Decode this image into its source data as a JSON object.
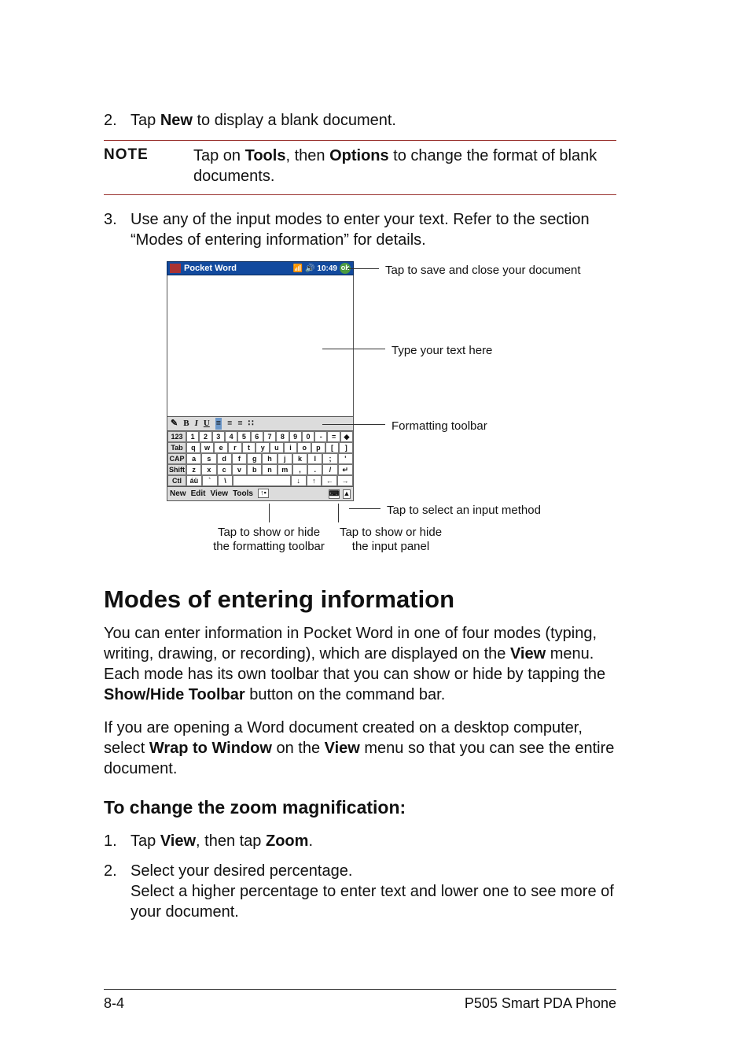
{
  "steps_top": {
    "s2": {
      "num": "2.",
      "before": "Tap ",
      "bold": "New",
      "after": " to display a blank document."
    }
  },
  "note": {
    "label": "NOTE",
    "t1": "Tap on ",
    "b1": "Tools",
    "t2": ", then ",
    "b2": "Options",
    "t3": " to change the format of blank documents."
  },
  "steps_mid": {
    "s3": {
      "num": "3.",
      "text": "Use any of the input modes to enter your text. Refer to the section “Modes of entering information” for details."
    }
  },
  "device": {
    "title": "Pocket Word",
    "time": "10:49",
    "ok": "ok",
    "fmt": {
      "B": "B",
      "I": "I",
      "U": "U"
    },
    "menus": {
      "new": "New",
      "edit": "Edit",
      "view": "View",
      "tools": "Tools"
    },
    "keys": {
      "row1": [
        "123",
        "1",
        "2",
        "3",
        "4",
        "5",
        "6",
        "7",
        "8",
        "9",
        "0",
        "-",
        "=",
        "◆"
      ],
      "row2": [
        "Tab",
        "q",
        "w",
        "e",
        "r",
        "t",
        "y",
        "u",
        "i",
        "o",
        "p",
        "[",
        "]"
      ],
      "row3": [
        "CAP",
        "a",
        "s",
        "d",
        "f",
        "g",
        "h",
        "j",
        "k",
        "l",
        ";",
        "'"
      ],
      "row4": [
        "Shift",
        "z",
        "x",
        "c",
        "v",
        "b",
        "n",
        "m",
        ",",
        ".",
        "/",
        "↵"
      ],
      "row5": [
        "Ctl",
        "áü",
        "`",
        "\\",
        " ",
        "↓",
        "↑",
        "←",
        "→"
      ]
    }
  },
  "callouts": {
    "save": "Tap to save and close your document",
    "type": "Type your text here",
    "fmt": "Formatting toolbar",
    "input_method": "Tap to select an input method",
    "toggle_fmt_l1": "Tap to show or hide",
    "toggle_fmt_l2": "the formatting toolbar",
    "toggle_panel_l1": "Tap to show or hide",
    "toggle_panel_l2": "the input panel"
  },
  "modes": {
    "heading": "Modes of entering information",
    "p1": {
      "t1": "You can enter information in Pocket Word in one of four modes (typing, writing, drawing, or recording), which are displayed on the ",
      "b1": "View",
      "t2": " menu. Each mode has its own toolbar that you can show or hide by tapping the ",
      "b2": "Show/Hide Toolbar",
      "t3": " button on the command bar."
    },
    "p2": {
      "t1": "If you are opening a Word document created on a desktop computer, select ",
      "b1": "Wrap to Window",
      "t2": " on the ",
      "b2": "View",
      "t3": " menu so that you can see the entire document."
    },
    "zoom_heading": "To change the zoom magnification:",
    "zoom_steps": {
      "s1": {
        "num": "1.",
        "t1": "Tap ",
        "b1": "View",
        "t2": ", then tap ",
        "b2": "Zoom",
        "t3": "."
      },
      "s2": {
        "num": "2.",
        "l1": "Select your desired percentage.",
        "l2": "Select a higher percentage to enter text and lower one to see more of your document."
      }
    }
  },
  "footer": {
    "left": "8-4",
    "right": "P505 Smart PDA Phone"
  }
}
